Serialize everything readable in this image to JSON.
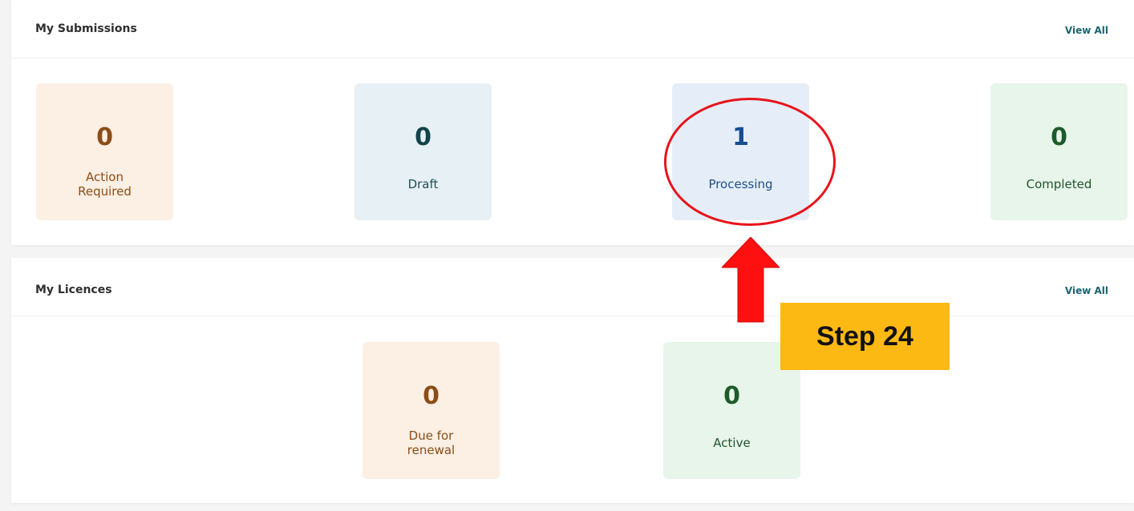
{
  "submissions": {
    "title": "My Submissions",
    "view_all": "View All",
    "cards": [
      {
        "count": "0",
        "label": "Action\nRequired"
      },
      {
        "count": "0",
        "label": "Draft"
      },
      {
        "count": "1",
        "label": "Processing"
      },
      {
        "count": "0",
        "label": "Completed"
      }
    ]
  },
  "licences": {
    "title": "My Licences",
    "view_all": "View All",
    "cards": [
      {
        "count": "0",
        "label": "Due for\nrenewal"
      },
      {
        "count": "0",
        "label": "Active"
      }
    ]
  },
  "annotation": {
    "step_label": "Step 24",
    "highlight_color": "#e8141b",
    "badge_color": "#fdb913"
  },
  "colors": {
    "orange_card": "#fcefe4",
    "teal_card": "#e7f0f4",
    "blue_card": "#e5eef8",
    "green_card": "#e8f5ea",
    "link": "#1c6470"
  }
}
